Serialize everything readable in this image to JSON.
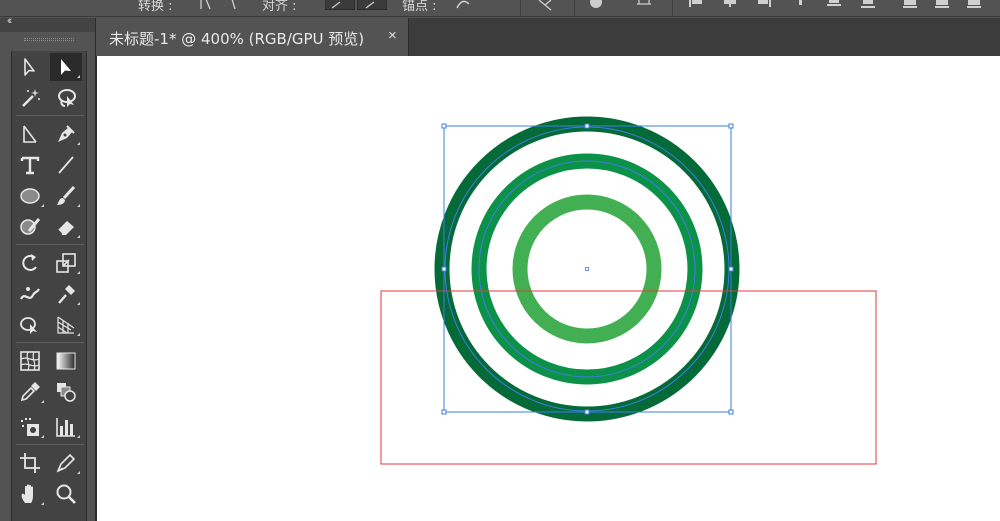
{
  "control_bar": {
    "label_transform": "转换 :",
    "label_anchor": "锚点 :",
    "label_align": "对齐 :"
  },
  "document_tab": {
    "title": "未标题-1* @ 400% (RGB/GPU 预览)",
    "close": "×"
  },
  "tool_panel": {
    "collapse": "‹‹"
  },
  "tools": [
    {
      "name": "direct-selection-tool-icon"
    },
    {
      "name": "selection-tool-icon",
      "active": true
    },
    {
      "name": "magic-wand-tool-icon"
    },
    {
      "name": "lasso-tool-icon"
    },
    {
      "name": "anchor-point-tool-icon"
    },
    {
      "name": "pen-tool-icon"
    },
    {
      "name": "type-tool-icon",
      "glyph": "T"
    },
    {
      "name": "line-segment-tool-icon"
    },
    {
      "name": "ellipse-tool-icon"
    },
    {
      "name": "paintbrush-tool-icon"
    },
    {
      "name": "shaper-tool-icon"
    },
    {
      "name": "eraser-tool-icon"
    },
    {
      "name": "rotate-tool-icon"
    },
    {
      "name": "scale-tool-icon"
    },
    {
      "name": "puppet-warp-tool-icon"
    },
    {
      "name": "symbol-sprayer-tool-icon"
    },
    {
      "name": "shape-builder-tool-icon"
    },
    {
      "name": "perspective-grid-tool-icon"
    },
    {
      "name": "mesh-tool-icon"
    },
    {
      "name": "gradient-tool-icon"
    },
    {
      "name": "eyedropper-tool-icon"
    },
    {
      "name": "blend-tool-icon"
    },
    {
      "name": "symbol-tool-icon"
    },
    {
      "name": "column-graph-tool-icon"
    },
    {
      "name": "artboard-tool-icon"
    },
    {
      "name": "slice-tool-icon"
    },
    {
      "name": "hand-tool-icon"
    },
    {
      "name": "zoom-tool-icon"
    }
  ],
  "colors": {
    "ring_outer": "#046a38",
    "ring_middle": "#0c9148",
    "ring_inner": "#42b052",
    "selection": "#3d7ee6",
    "artboard_border": "#e03a3a",
    "ui_background": "#535353",
    "ui_dark": "#434343",
    "tab_bar": "#3c3c3c"
  }
}
